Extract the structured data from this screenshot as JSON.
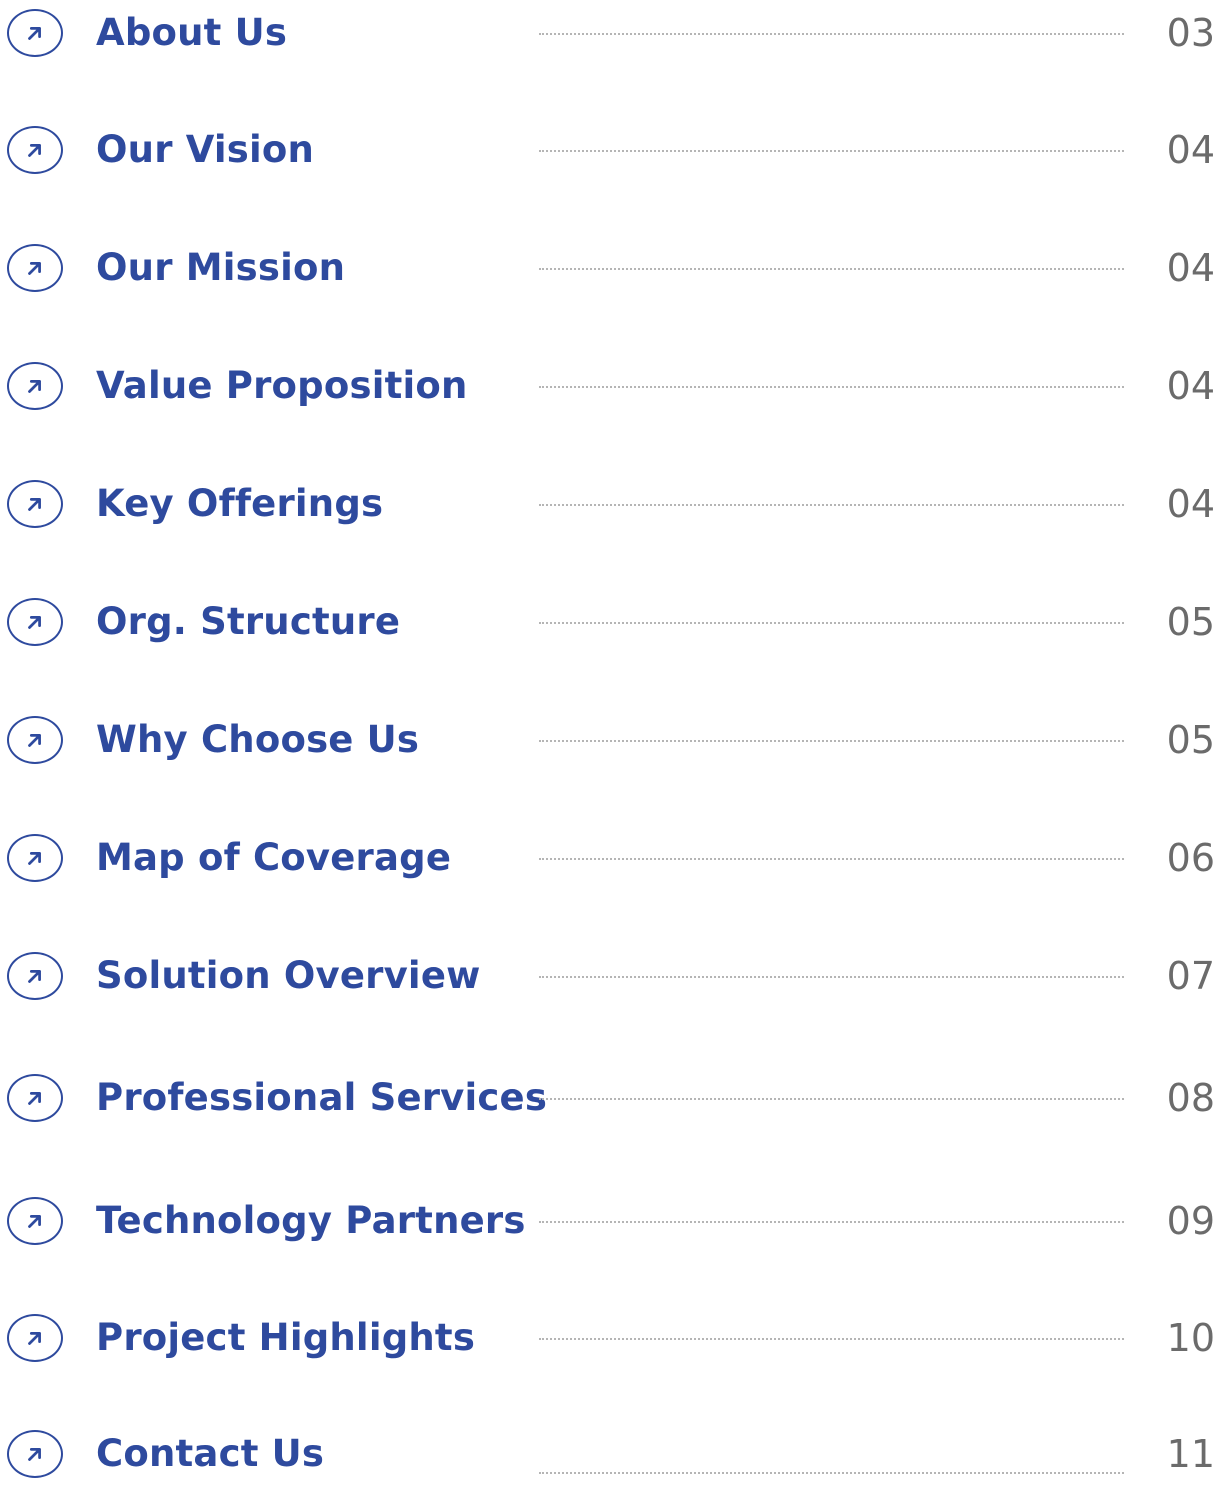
{
  "toc": {
    "accent_color": "#2e4a9e",
    "page_number_color": "#6b6b6b",
    "leader_color": "#b5b5b5",
    "item_icon": "arrow-up-right-icon",
    "items": [
      {
        "title": "About Us",
        "page": "03"
      },
      {
        "title": "Our Vision",
        "page": "04"
      },
      {
        "title": "Our Mission",
        "page": "04"
      },
      {
        "title": "Value Proposition",
        "page": "04"
      },
      {
        "title": "Key Offerings",
        "page": "04"
      },
      {
        "title": "Org. Structure",
        "page": "05"
      },
      {
        "title": "Why Choose Us",
        "page": "05"
      },
      {
        "title": "Map of Coverage",
        "page": "06"
      },
      {
        "title": "Solution Overview",
        "page": "07"
      },
      {
        "title": "Professional Services",
        "page": "08"
      },
      {
        "title": "Technology Partners",
        "page": "09"
      },
      {
        "title": "Project Highlights",
        "page": "10"
      },
      {
        "title": "Contact Us",
        "page": "11"
      }
    ]
  }
}
